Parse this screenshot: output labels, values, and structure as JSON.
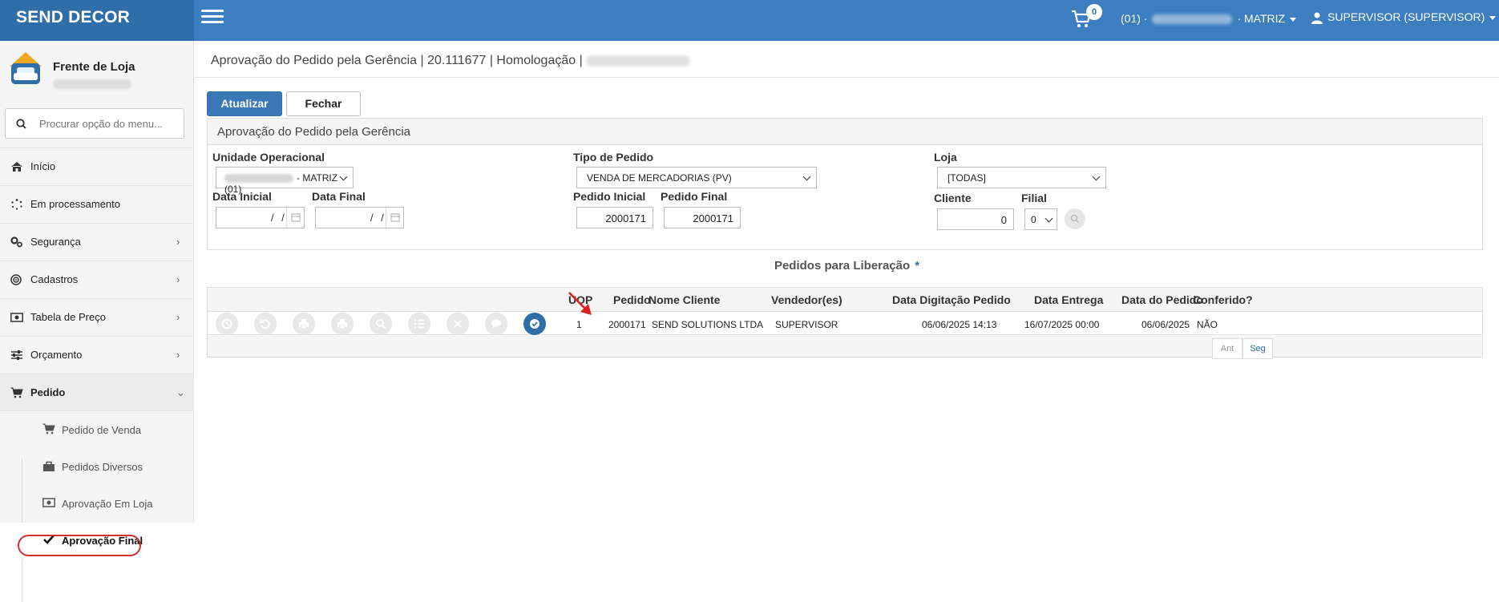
{
  "app": {
    "brand": "SEND DECOR",
    "cart_count": "0",
    "company_prefix": "(01) ·",
    "company_suffix": "· MATRIZ",
    "user": "SUPERVISOR (SUPERVISOR)"
  },
  "sidebar": {
    "store_name": "Frente de Loja",
    "search_placeholder": "Procurar opção do menu...",
    "items": [
      {
        "label": "Início",
        "icon": "home-icon"
      },
      {
        "label": "Em processamento",
        "icon": "spinner-icon"
      },
      {
        "label": "Segurança",
        "icon": "gears-icon"
      },
      {
        "label": "Cadastros",
        "icon": "target-icon"
      },
      {
        "label": "Tabela de Preço",
        "icon": "money-icon"
      },
      {
        "label": "Orçamento",
        "icon": "sliders-icon"
      },
      {
        "label": "Pedido",
        "icon": "cart-icon"
      }
    ],
    "subitems": [
      {
        "label": "Pedido de Venda",
        "icon": "cart-icon"
      },
      {
        "label": "Pedidos Diversos",
        "icon": "bag-icon"
      },
      {
        "label": "Aprovação Em Loja",
        "icon": "money-icon"
      },
      {
        "label": "Aprovação Final",
        "icon": "check-icon"
      }
    ]
  },
  "page": {
    "title": "Aprovação do Pedido pela Gerência | 20.111677 | Homologação |",
    "btn_update": "Atualizar",
    "btn_close": "Fechar",
    "panel_title": "Aprovação do Pedido pela Gerência"
  },
  "filters": {
    "unidade_label": "Unidade Operacional",
    "unidade_value": "- MATRIZ (01)",
    "data_inicial_label": "Data Inicial",
    "data_final_label": "Data Final",
    "date_mask": "/ /",
    "tipo_label": "Tipo de Pedido",
    "tipo_value": "VENDA DE MERCADORIAS (PV)",
    "pedido_inicial_label": "Pedido Inicial",
    "pedido_inicial_value": "2000171",
    "pedido_final_label": "Pedido Final",
    "pedido_final_value": "2000171",
    "loja_label": "Loja",
    "loja_value": "[TODAS]",
    "cliente_label": "Cliente",
    "cliente_value": "0",
    "filial_label": "Filial",
    "filial_value": "0"
  },
  "orders": {
    "section_title": "Pedidos para Liberação",
    "required_mark": "*",
    "columns": [
      "UOP",
      "Pedido",
      "Nome Cliente",
      "Vendedor(es)",
      "Data Digitação Pedido",
      "Data Entrega",
      "Data do Pedido",
      "Conferido?"
    ],
    "rows": [
      {
        "uop": "1",
        "pedido": "2000171",
        "cliente": "SEND SOLUTIONS LTDA",
        "vendedor": "SUPERVISOR",
        "data_digitacao": "06/06/2025 14:13",
        "data_entrega": "16/07/2025 00:00",
        "data_pedido": "06/06/2025",
        "conferido": "NÃO"
      }
    ],
    "pager_prev": "Ant",
    "pager_next": "Seg"
  },
  "colors": {
    "header_blue": "#3c7ebf",
    "brand_blue": "#2f6ea8",
    "highlight_red": "#d32f2f"
  }
}
